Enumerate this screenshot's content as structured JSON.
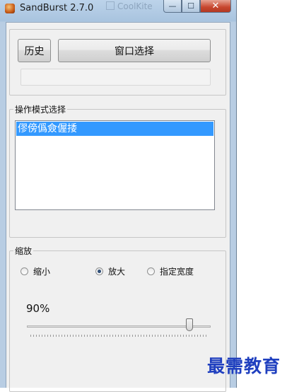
{
  "window": {
    "title": "SandBurst 2.7.0",
    "background_tab": "CoolKite",
    "buttons": {
      "minimize": "—",
      "maximize": "☐",
      "close": "✕"
    }
  },
  "toolbar": {
    "history_label": "历史",
    "window_select_label": "窗口选择",
    "progress": 0
  },
  "mode_group": {
    "legend": "操作模式选择",
    "items": [
      {
        "label": "僇傍僞僉偓捼",
        "selected": true
      }
    ]
  },
  "zoom_group": {
    "legend": "缩放",
    "options": [
      {
        "label": "缩小",
        "checked": false
      },
      {
        "label": "放大",
        "checked": true
      },
      {
        "label": "指定宽度",
        "checked": false
      }
    ],
    "value_text": "90%",
    "slider_value": 0.9
  },
  "watermark": "最需教育",
  "colors": {
    "selection": "#3399ff",
    "watermark": "#1f3fbf",
    "close_button": "#c7462e"
  },
  "icons": {
    "app": "sandburst-app-icon",
    "minimize": "minimize-icon",
    "maximize": "maximize-icon",
    "close": "close-icon"
  }
}
